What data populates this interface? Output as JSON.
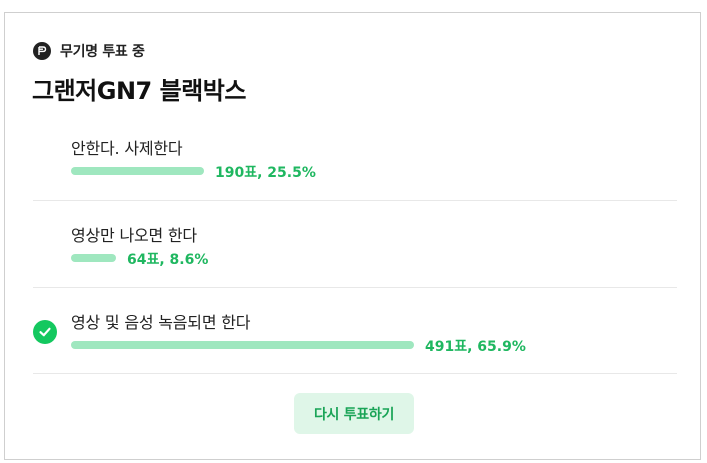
{
  "poll": {
    "status_label": "무기명 투표 중",
    "title": "그랜저GN7 블랙박스",
    "options": [
      {
        "label": "안한다. 사제한다",
        "votes": 190,
        "percent": 25.5,
        "result_text": "190표, 25.5%",
        "selected": false
      },
      {
        "label": "영상만 나오면 한다",
        "votes": 64,
        "percent": 8.6,
        "result_text": "64표, 8.6%",
        "selected": false
      },
      {
        "label": "영상 및 음성 녹음되면 한다",
        "votes": 491,
        "percent": 65.9,
        "result_text": "491표, 65.9%",
        "selected": true
      }
    ],
    "revote_label": "다시 투표하기"
  },
  "colors": {
    "bar": "#9fe7bf",
    "result_text": "#1fb760",
    "check": "#14c85f",
    "button_bg": "#dff6e8",
    "button_text": "#1aa457"
  },
  "icons": {
    "status": "vote-badge-icon",
    "selected": "check-circle-icon"
  }
}
